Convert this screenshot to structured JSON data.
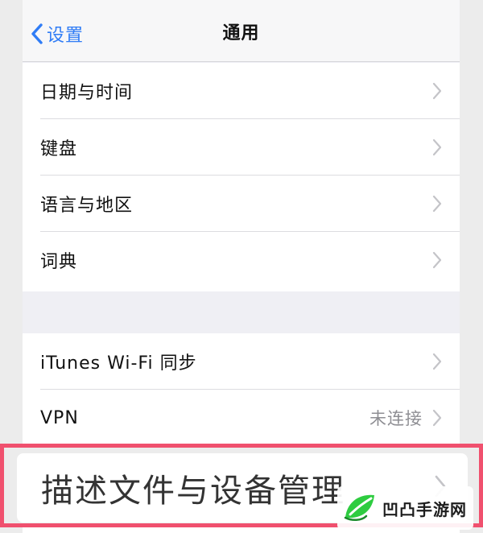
{
  "navbar": {
    "back_label": "设置",
    "title": "通用"
  },
  "group1": [
    {
      "label": "日期与时间"
    },
    {
      "label": "键盘"
    },
    {
      "label": "语言与地区"
    },
    {
      "label": "词典"
    }
  ],
  "group2": [
    {
      "label": "iTunes Wi-Fi 同步",
      "value": ""
    },
    {
      "label": "VPN",
      "value": "未连接"
    }
  ],
  "highlighted": {
    "label": "描述文件与设备管理"
  },
  "watermark": {
    "text": "凹凸手游网"
  },
  "colors": {
    "accent": "#2f7cf6",
    "highlight_border": "#f0506e",
    "logo_green": "#2ecc40"
  },
  "icons": {
    "back": "chevron-left-icon",
    "row": "chevron-right-icon",
    "logo": "leaf-logo-icon"
  }
}
